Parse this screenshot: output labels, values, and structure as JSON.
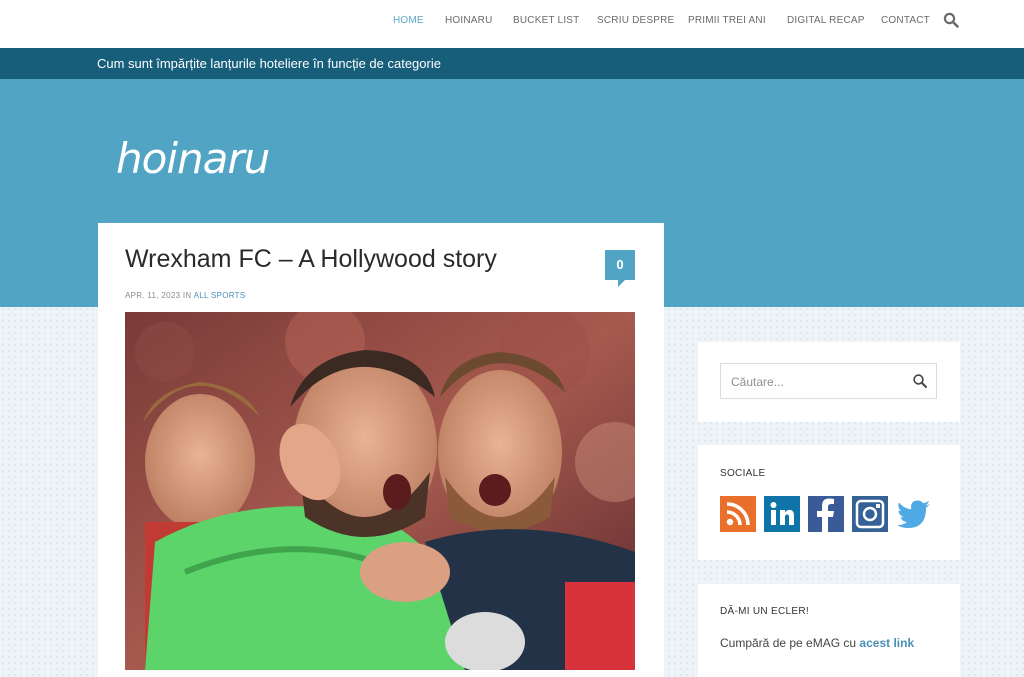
{
  "nav": {
    "items": [
      {
        "label": "HOME",
        "active": true
      },
      {
        "label": "HOINARU",
        "active": false
      },
      {
        "label": "BUCKET LIST",
        "active": false
      },
      {
        "label": "SCRIU DESPRE",
        "active": false
      },
      {
        "label": "PRIMII TREI ANI",
        "active": false
      },
      {
        "label": "DIGITAL RECAP",
        "active": false
      },
      {
        "label": "CONTACT",
        "active": false
      }
    ],
    "search_icon": "search-icon"
  },
  "ticker": {
    "text": "Cum sunt împărțite lanțurile hoteliere în funcție de categorie"
  },
  "site": {
    "logo_text": "hoinaru"
  },
  "article": {
    "title": "Wrexham FC – A Hollywood story",
    "comment_count": "0",
    "date": "APR. 11, 2023",
    "in_word": "IN",
    "category": "ALL SPORTS"
  },
  "sidebar": {
    "search": {
      "placeholder": "Căutare..."
    },
    "social": {
      "title": "SOCIALE",
      "icons": [
        "rss-icon",
        "linkedin-icon",
        "facebook-icon",
        "instagram-icon",
        "twitter-icon"
      ]
    },
    "ecler": {
      "title": "DĂ-MI UN ECLER!",
      "text_prefix": "Cumpără de pe eMAG cu",
      "link_text": "acest link"
    }
  },
  "colors": {
    "header_blue": "#52a4c4",
    "ticker_blue": "#165e7a",
    "accent_link": "#4a90b8",
    "nav_active": "#5da8c8",
    "rss_orange": "#e9702a",
    "linkedin_blue": "#0f74a8",
    "facebook_blue": "#3b5a98",
    "instagram_blue": "#356296",
    "twitter_blue": "#4fa9e4"
  }
}
